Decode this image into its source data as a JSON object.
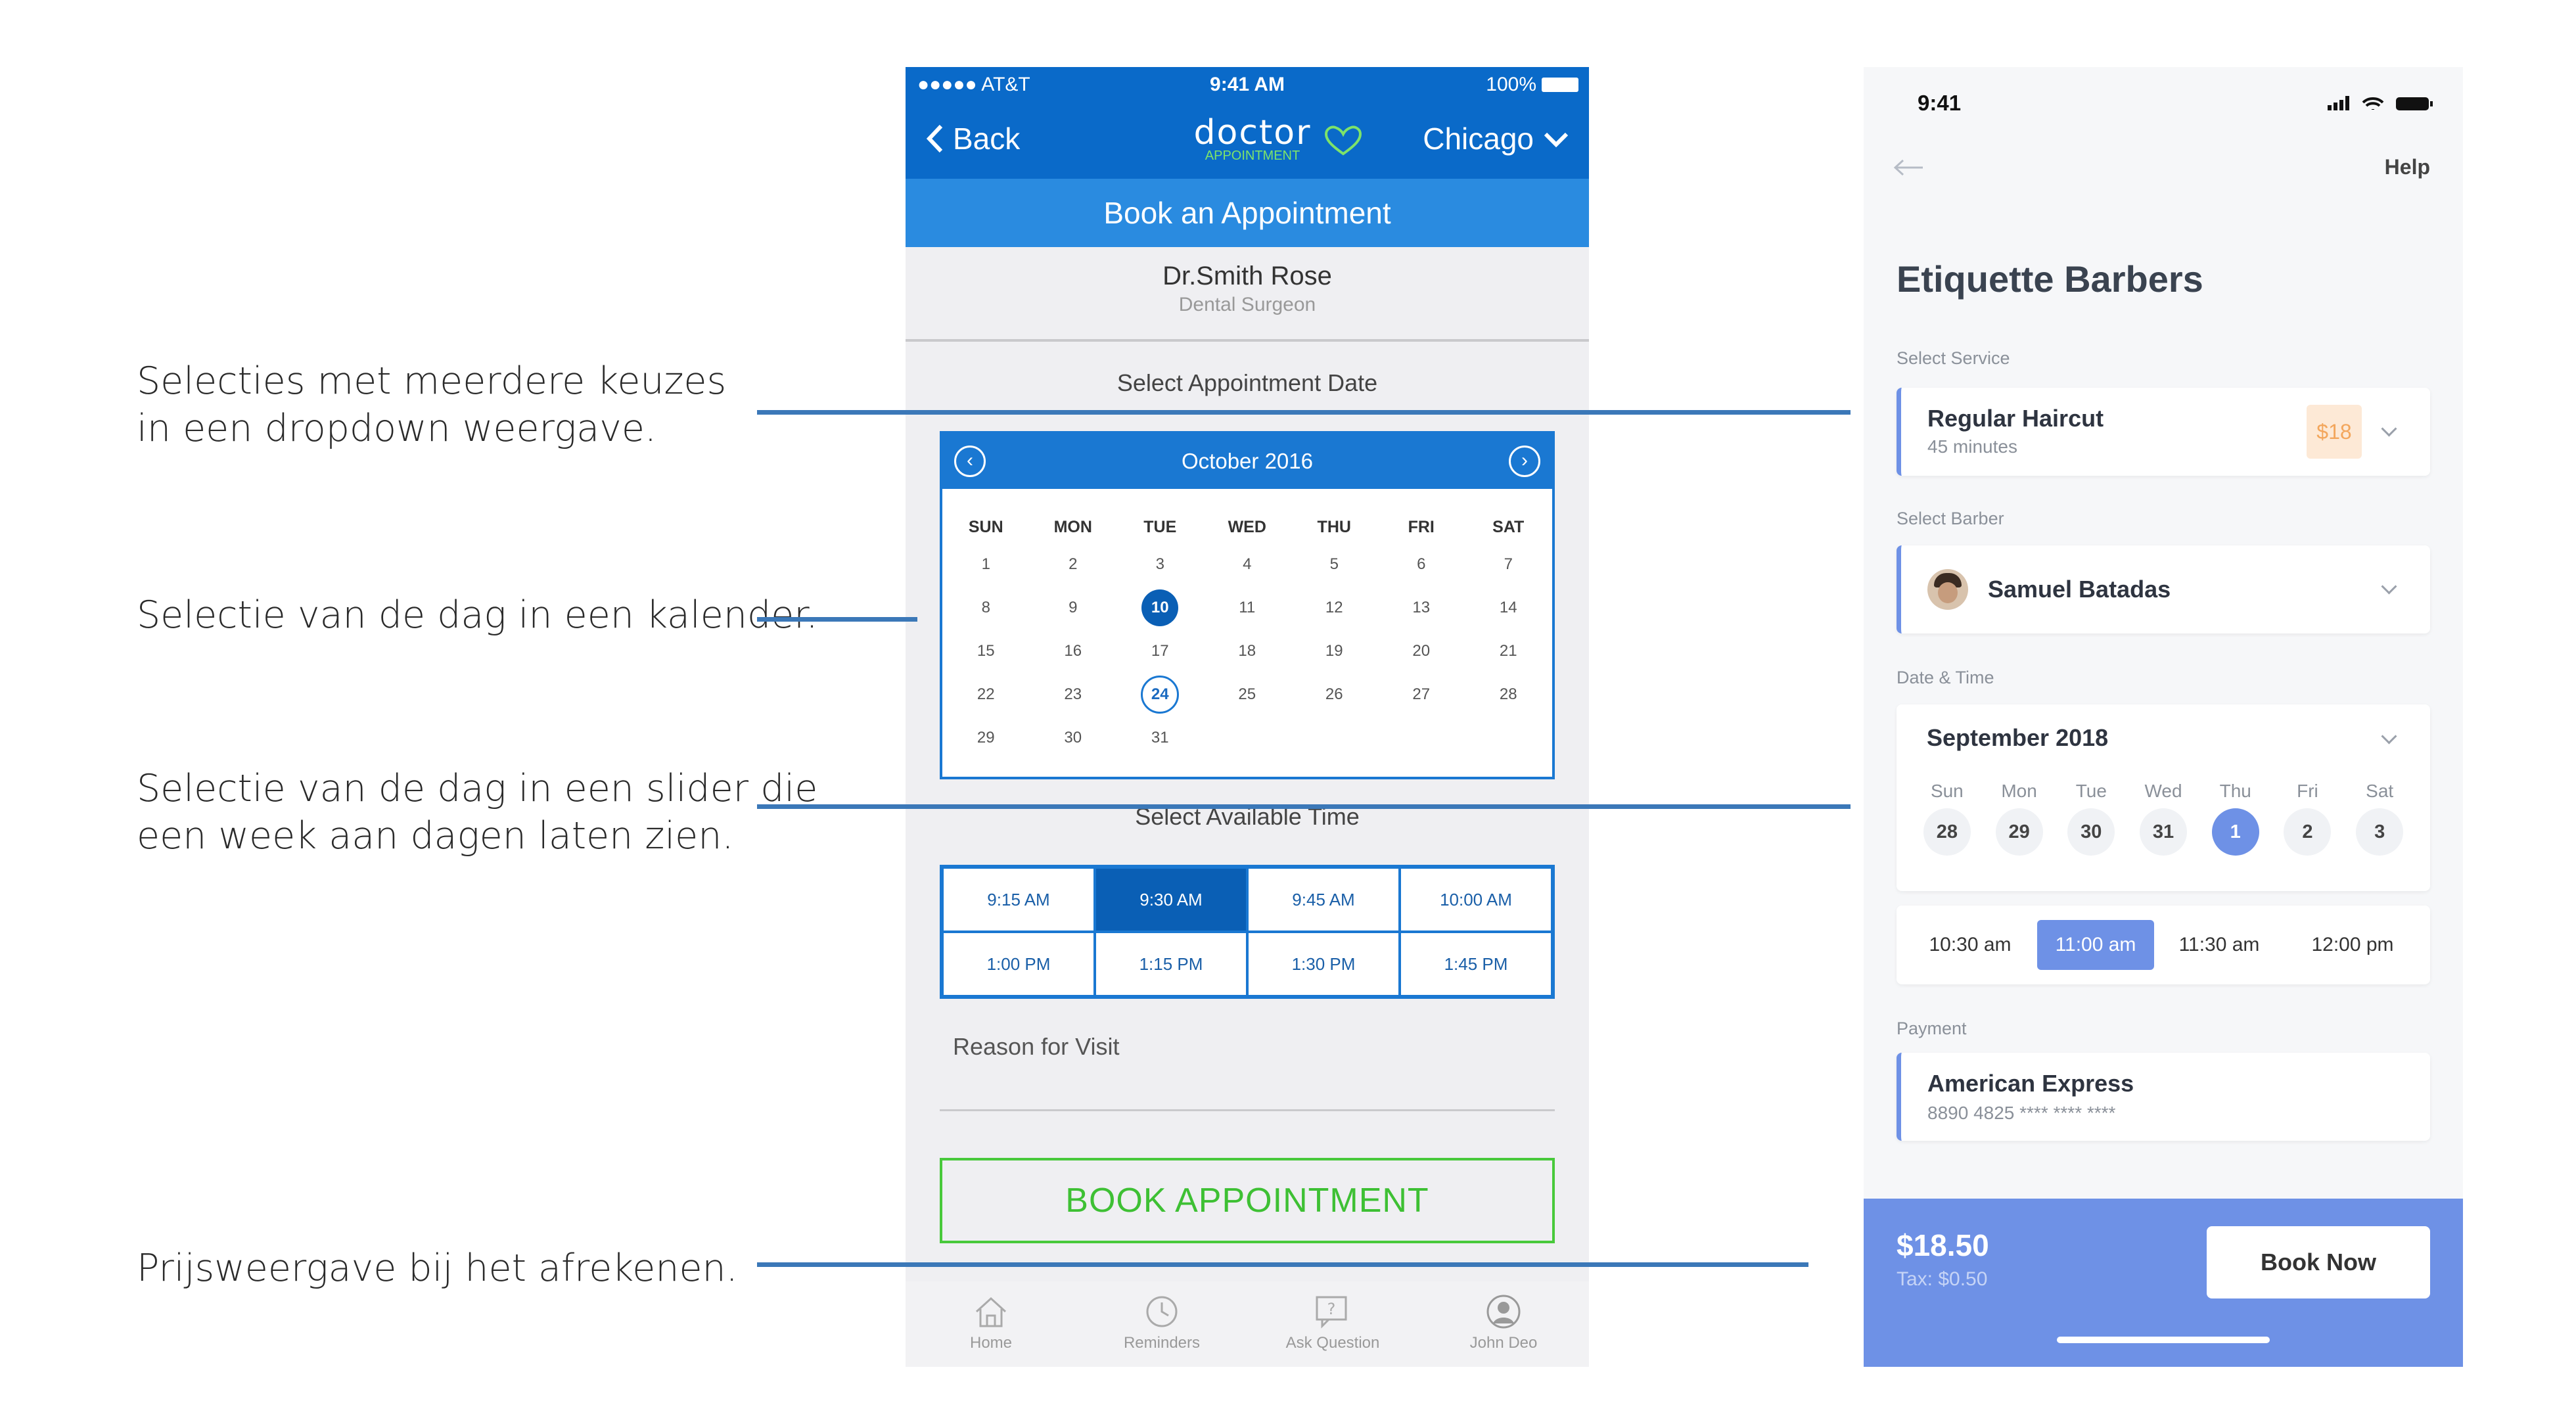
{
  "annotations": [
    {
      "line1": "Selecties met meerdere keuzes",
      "line2": "in een dropdown weergave."
    },
    {
      "line1": "Selectie van de dag in een kalender.",
      "line2": ""
    },
    {
      "line1": "Selectie van de dag in een slider die",
      "line2": "een week aan dagen laten zien."
    },
    {
      "line1": "Prijsweergave bij het afrekenen.",
      "line2": ""
    }
  ],
  "app1": {
    "status": {
      "carrier": "●●●●● AT&T",
      "time": "9:41 AM",
      "battery": "100%"
    },
    "nav": {
      "back": "Back",
      "logo_main": "doctor",
      "logo_sub": "APPOINTMENT",
      "city": "Chicago"
    },
    "band_title": "Book an Appointment",
    "doctor": {
      "name": "Dr.Smith Rose",
      "role": "Dental Surgeon"
    },
    "date_label": "Select Appointment Date",
    "calendar": {
      "month": "October 2016",
      "weekdays": [
        "SUN",
        "MON",
        "TUE",
        "WED",
        "THU",
        "FRI",
        "SAT"
      ],
      "weeks": [
        [
          "1",
          "2",
          "3",
          "4",
          "5",
          "6",
          "7"
        ],
        [
          "8",
          "9",
          "10",
          "11",
          "12",
          "13",
          "14"
        ],
        [
          "15",
          "16",
          "17",
          "18",
          "19",
          "20",
          "21"
        ],
        [
          "22",
          "23",
          "24",
          "25",
          "26",
          "27",
          "28"
        ],
        [
          "29",
          "30",
          "31",
          "",
          "",
          "",
          ""
        ]
      ],
      "selected": "10",
      "today": "24"
    },
    "time_label": "Select Available Time",
    "times": [
      "9:15 AM",
      "9:30 AM",
      "9:45 AM",
      "10:00 AM",
      "1:00 PM",
      "1:15 PM",
      "1:30 PM",
      "1:45 PM"
    ],
    "selected_time": "9:30 AM",
    "reason_label": "Reason for Visit",
    "book_button": "BOOK APPOINTMENT",
    "tabs": [
      "Home",
      "Reminders",
      "Ask Question",
      "John Deo"
    ]
  },
  "app2": {
    "status_time": "9:41",
    "help": "Help",
    "title": "Etiquette Barbers",
    "service_label": "Select Service",
    "service": {
      "name": "Regular Haircut",
      "duration": "45 minutes",
      "price": "$18"
    },
    "barber_label": "Select Barber",
    "barber": "Samuel Batadas",
    "datetime_label": "Date & Time",
    "month": "September 2018",
    "week": [
      {
        "d": "Sun",
        "n": "28"
      },
      {
        "d": "Mon",
        "n": "29"
      },
      {
        "d": "Tue",
        "n": "30"
      },
      {
        "d": "Wed",
        "n": "31"
      },
      {
        "d": "Thu",
        "n": "1"
      },
      {
        "d": "Fri",
        "n": "2"
      },
      {
        "d": "Sat",
        "n": "3"
      }
    ],
    "selected_day": "1",
    "slots": [
      "10:30 am",
      "11:00 am",
      "11:30 am",
      "12:00 pm"
    ],
    "selected_slot": "11:00 am",
    "payment_label": "Payment",
    "payment": {
      "name": "American Express",
      "number": "8890 4825 **** **** ****"
    },
    "total": "$18.50",
    "tax": "Tax: $0.50",
    "book_now": "Book Now"
  },
  "colors": {
    "app1_blue": "#0a6ac9",
    "app1_green": "#48c93b",
    "app2_accent": "#6e91e6",
    "line": "#3b78b8"
  }
}
